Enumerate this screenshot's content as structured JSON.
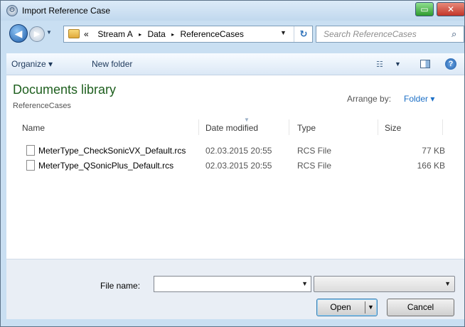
{
  "window": {
    "title": "Import Reference Case",
    "maximize_glyph": "▭",
    "close_glyph": "✕"
  },
  "nav": {
    "breadcrumb_prefix": "«",
    "breadcrumbs": [
      "Stream A",
      "Data",
      "ReferenceCases"
    ],
    "separator": "▸",
    "search_placeholder": "Search ReferenceCases",
    "icons": {
      "back": "back-arrow-icon",
      "forward": "forward-arrow-icon",
      "refresh": "refresh-icon",
      "search": "search-icon"
    }
  },
  "toolbar": {
    "organize_label": "Organize ▾",
    "new_folder_label": "New folder",
    "views_glyph": "☷",
    "views_dd": "▼",
    "help_glyph": "?"
  },
  "library": {
    "title": "Documents library",
    "subtitle": "ReferenceCases",
    "arrange_label": "Arrange by:",
    "arrange_value": "Folder ▾"
  },
  "table": {
    "columns": [
      "Name",
      "Date modified",
      "Type",
      "Size"
    ],
    "rows": [
      {
        "name": "MeterType_CheckSonicVX_Default.rcs",
        "date": "02.03.2015 20:55",
        "type": "RCS File",
        "size": "77 KB"
      },
      {
        "name": "MeterType_QSonicPlus_Default.rcs",
        "date": "02.03.2015 20:55",
        "type": "RCS File",
        "size": "166 KB"
      }
    ]
  },
  "footer": {
    "file_name_label": "File name:",
    "file_name_value": "",
    "file_type_value": "",
    "open_label": "Open",
    "cancel_label": "Cancel"
  },
  "colors": {
    "library_title": "#1e5f1e",
    "link_blue": "#1b6fc6",
    "frame": "#c9dff2"
  }
}
